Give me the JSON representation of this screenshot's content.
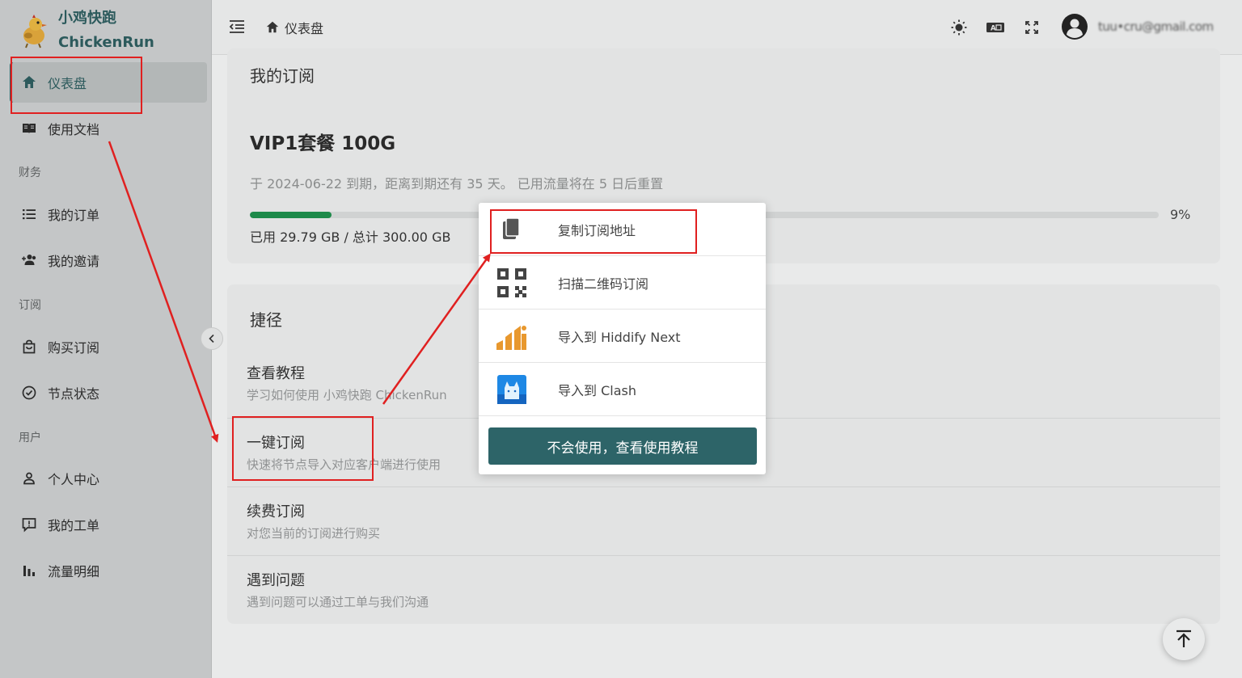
{
  "brand": {
    "name_cn": "小鸡快跑",
    "name_en": "ChickenRun"
  },
  "sidebar": {
    "items": [
      {
        "label": "仪表盘",
        "icon": "home-icon",
        "active": true
      },
      {
        "label": "使用文档",
        "icon": "book-icon"
      }
    ],
    "groups": [
      {
        "title": "财务",
        "items": [
          {
            "label": "我的订单",
            "icon": "list-icon"
          },
          {
            "label": "我的邀请",
            "icon": "people-add-icon"
          }
        ]
      },
      {
        "title": "订阅",
        "items": [
          {
            "label": "购买订阅",
            "icon": "shopping-bag-icon"
          },
          {
            "label": "节点状态",
            "icon": "check-circle-icon"
          }
        ]
      },
      {
        "title": "用户",
        "items": [
          {
            "label": "个人中心",
            "icon": "person-icon"
          },
          {
            "label": "我的工单",
            "icon": "ticket-icon"
          },
          {
            "label": "流量明细",
            "icon": "bar-chart-icon"
          }
        ]
      }
    ]
  },
  "header": {
    "breadcrumb": "仪表盘",
    "username": "tuu•cru@gmail.com"
  },
  "subscription": {
    "title": "我的订阅",
    "plan": "VIP1套餐 100G",
    "info": "于 2024-06-22 到期，距离到期还有 35 天。 已用流量将在 5 日后重置",
    "progress_percent": 9,
    "progress_label": "9%",
    "usage": "已用 29.79 GB / 总计 300.00 GB"
  },
  "shortcuts": {
    "title": "捷径",
    "rows": [
      {
        "title": "查看教程",
        "desc": "学习如何使用 小鸡快跑 ChickenRun"
      },
      {
        "title": "一键订阅",
        "desc": "快速将节点导入对应客户端进行使用"
      },
      {
        "title": "续费订阅",
        "desc": "对您当前的订阅进行购买"
      },
      {
        "title": "遇到问题",
        "desc": "遇到问题可以通过工单与我们沟通"
      }
    ]
  },
  "popup": {
    "items": [
      {
        "label": "复制订阅地址",
        "icon": "copy-icon"
      },
      {
        "label": "扫描二维码订阅",
        "icon": "qrcode-icon"
      },
      {
        "label": "导入到 Hiddify Next",
        "icon": "hiddify-icon"
      },
      {
        "label": "导入到 Clash",
        "icon": "clash-icon"
      }
    ],
    "button": "不会使用，查看使用教程"
  },
  "colors": {
    "accent": "#2d6468",
    "progress": "#1e8a4a",
    "annotation": "#e02020"
  }
}
